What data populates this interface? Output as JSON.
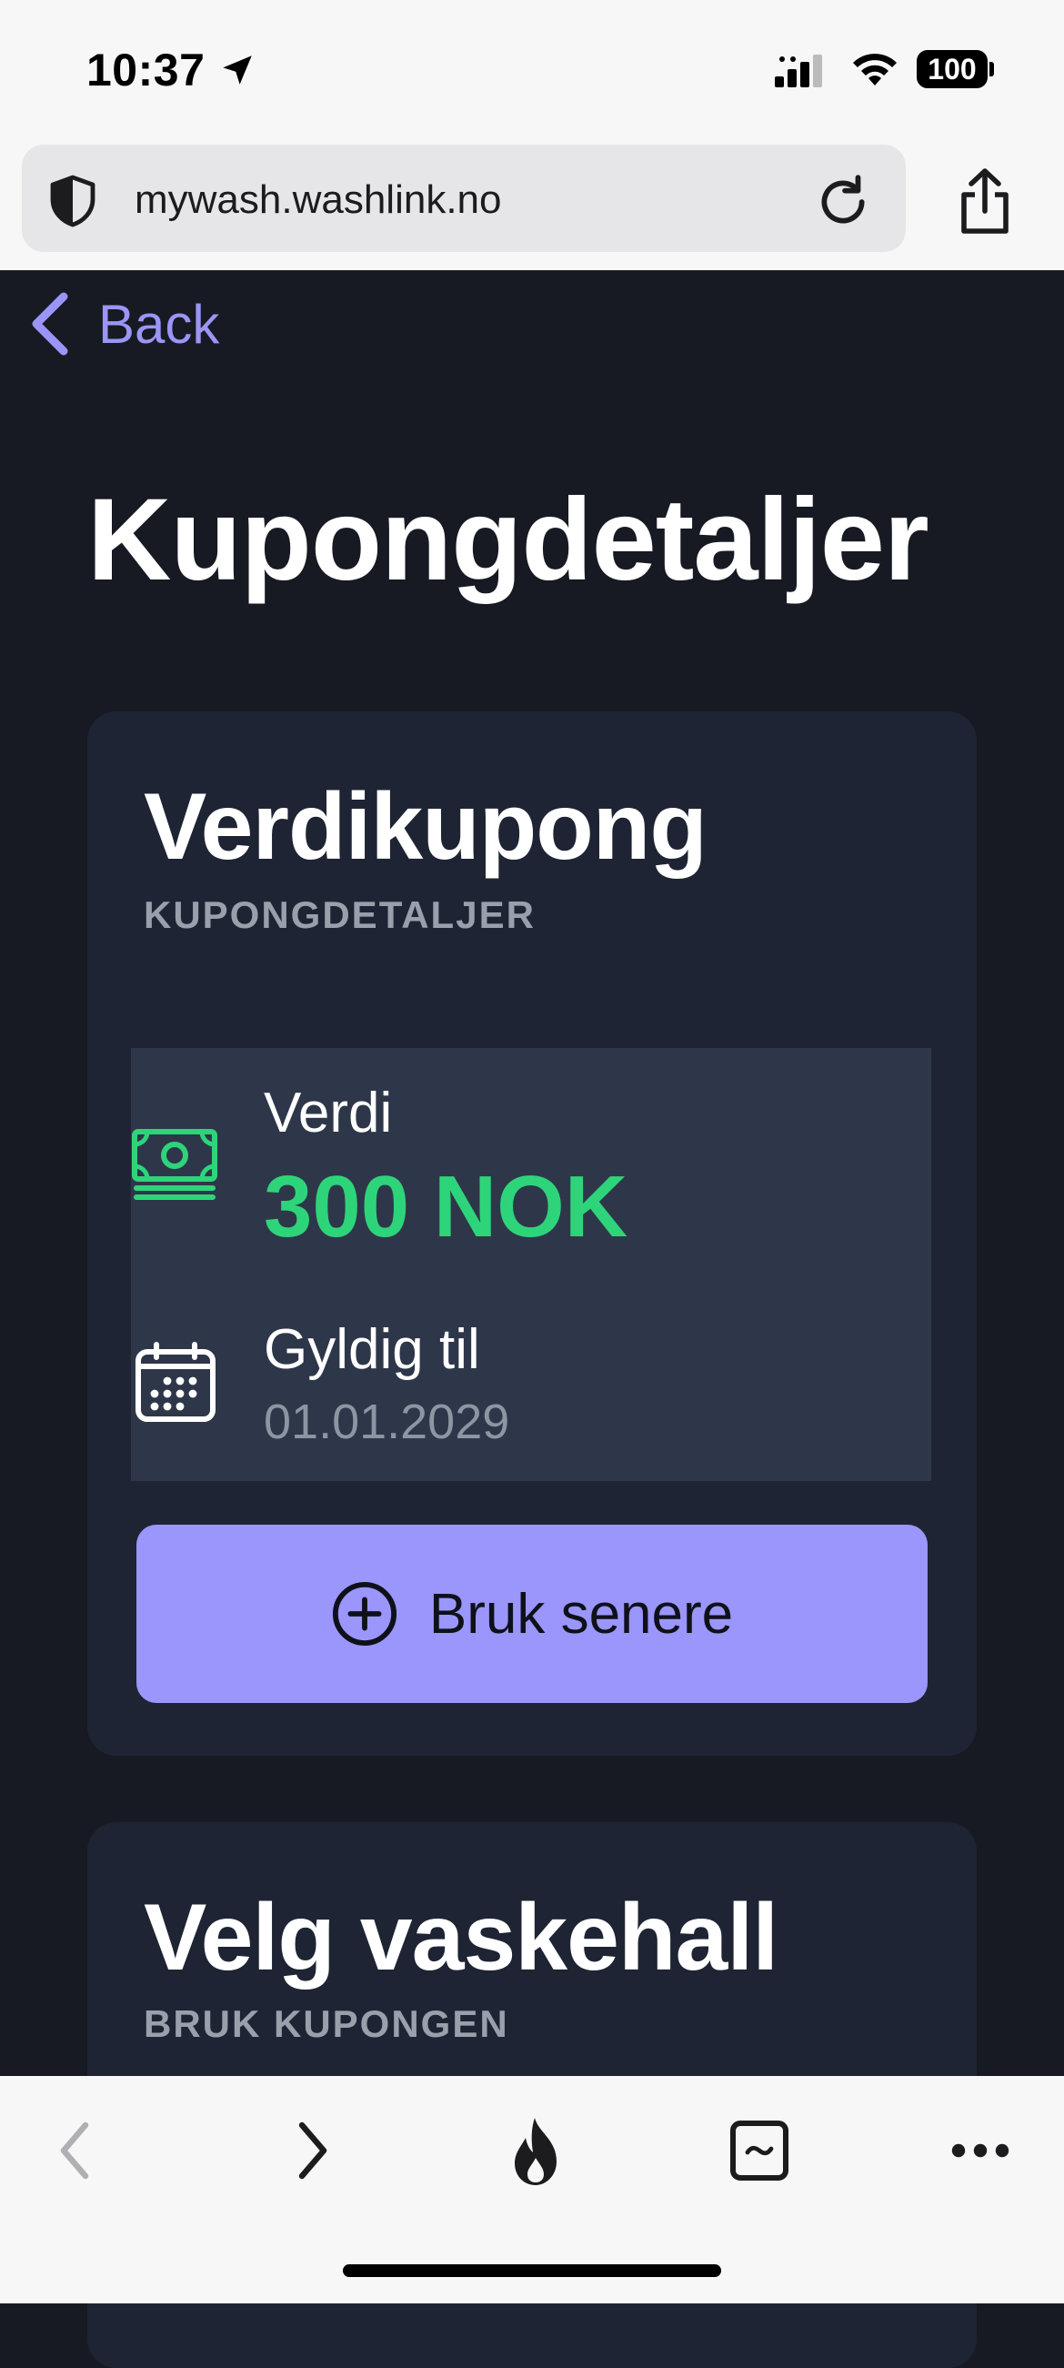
{
  "status_bar": {
    "time": "10:37",
    "battery": "100"
  },
  "browser": {
    "url": "mywash.washlink.no"
  },
  "nav": {
    "back_label": "Back"
  },
  "page": {
    "title": "Kupongdetaljer"
  },
  "coupon_card": {
    "title": "Verdikupong",
    "subtitle": "KUPONGDETALJER",
    "value_label": "Verdi",
    "value": "300 NOK",
    "valid_label": "Gyldig til",
    "valid_date": "01.01.2029",
    "button_label": "Bruk senere"
  },
  "hall_card": {
    "title": "Velg vaskehall",
    "subtitle": "BRUK KUPONGEN"
  },
  "colors": {
    "background": "#171a22",
    "card": "#1e2433",
    "accent": "#9b96fb",
    "value_green": "#2ed47a"
  },
  "icons": [
    "location-arrow-icon",
    "signal-icon",
    "wifi-icon",
    "shield-icon",
    "reload-icon",
    "share-icon",
    "chevron-left-icon",
    "money-icon",
    "calendar-icon",
    "plus-circle-icon",
    "flame-icon",
    "tabs-icon",
    "more-icon"
  ]
}
